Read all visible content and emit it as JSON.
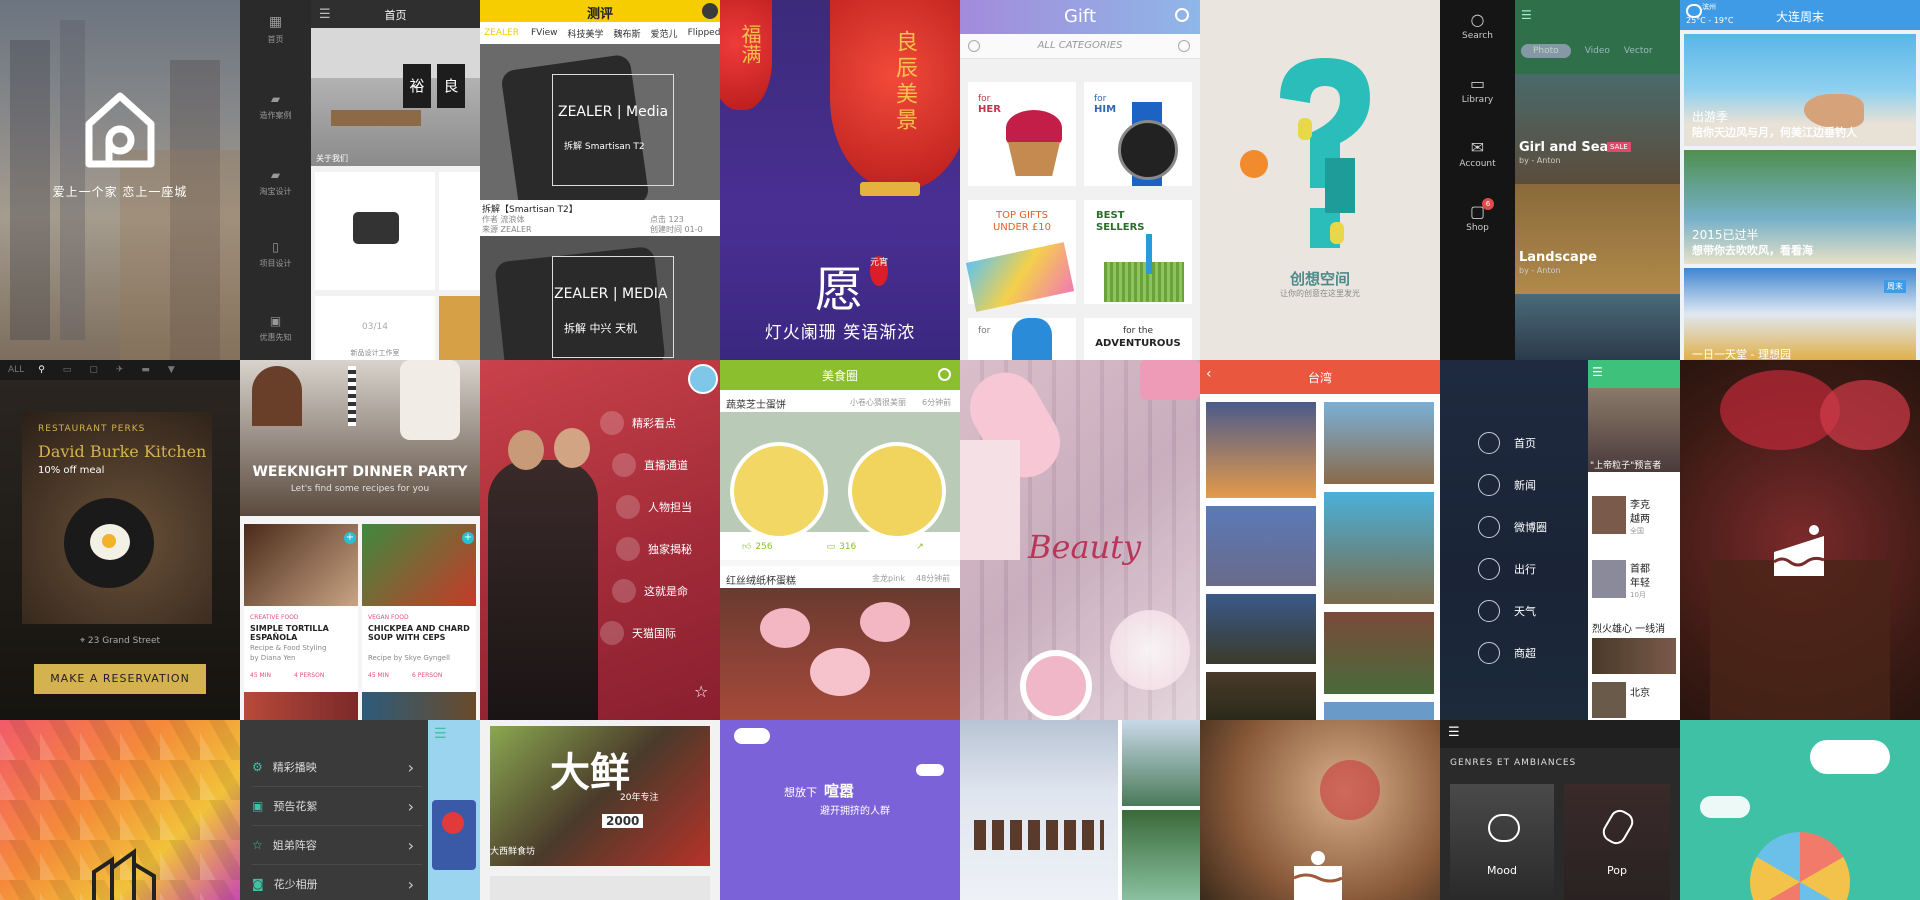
{
  "t_home": {
    "slogan": "爱上一个家 恋上一座城"
  },
  "t_interior": {
    "title": "首页",
    "sidebar": [
      "首页",
      "造作案例",
      "淘宝设计",
      "项目设计",
      "优惠先知"
    ],
    "label_about": "关于我们",
    "page": "03/14",
    "footer": "新品设计工作室",
    "sign_a": "裕",
    "sign_b": "良"
  },
  "t_zealer": {
    "brand": "测评",
    "tabs": [
      "ZEALER",
      "FView",
      "科技美学",
      "魏布斯",
      "爱范儿",
      "Flipped"
    ],
    "card1_logo": "ZEALER | Media",
    "card1_sub": "拆解 Smartisan T2",
    "item_title": "拆解【Smartisan T2】",
    "item_meta1": "作者 流浪体",
    "item_meta2": "来源 ZEALER",
    "item_right1": "点击 123",
    "item_right2": "创建时间 01-0",
    "card2_logo": "ZEALER | MEDIA",
    "card2_sub": "拆解 中兴 天机"
  },
  "t_lantern": {
    "big": "愿",
    "seal": "元宵",
    "line": "灯火阑珊 笑语渐浓",
    "lantern1": "福满",
    "lantern2": "良辰美景"
  },
  "t_gift": {
    "title": "Gift",
    "categories": "ALL CATEGORIES",
    "cells": [
      {
        "pre": "for",
        "main": "HER"
      },
      {
        "pre": "for",
        "main": "HIM"
      },
      {
        "pre": "",
        "main": "TOP GIFTS UNDER £10"
      },
      {
        "pre": "",
        "main": "BEST SELLERS"
      },
      {
        "pre": "",
        "main": "for"
      },
      {
        "pre": "for the",
        "main": "ADVENTUROUS"
      }
    ]
  },
  "t_idea": {
    "name": "创想空间",
    "sub": "让你的创意在这里发光"
  },
  "t_music": {
    "nav": [
      "Search",
      "Library",
      "Account",
      "Shop"
    ],
    "badge": "6",
    "tabs": [
      "Photo",
      "Video",
      "Vector"
    ],
    "items": [
      {
        "title": "Girl and Sea",
        "by": "by - Anton",
        "tag": "SALE"
      },
      {
        "title": "Landscape",
        "by": "by - Anton",
        "tag": ""
      }
    ]
  },
  "t_dalian": {
    "city": "滨州",
    "temp": "25°C - 19°C",
    "title": "大连周末",
    "cards": [
      {
        "a": "出游季",
        "b": "陪你天边风与月，何美江边垂钓人"
      },
      {
        "a": "2015已过半",
        "b": "想带你去吹吹风，看看海"
      },
      {
        "a": "",
        "b": "一日一天堂 - 理想园"
      }
    ],
    "tag": "周末"
  },
  "t_restaurant": {
    "menu": [
      "ALL"
    ],
    "perks": "RESTAURANT PERKS",
    "name": "David Burke Kitchen",
    "off": "10% off meal",
    "address": "23 Grand Street",
    "cta": "MAKE A RESERVATION"
  },
  "t_dinner": {
    "title": "WEEKNIGHT DINNER PARTY",
    "sub": "Let's find some recipes for you",
    "c1_tag": "CREATIVE FOOD",
    "c1_title": "SIMPLE TORTILLA ESPAÑOLA",
    "c1_by": "Recipe & Food Styling",
    "c1_by2": "by Diana Yen",
    "c1_time": "45 MIN",
    "c1_person": "4 PERSON",
    "c2_tag": "VEGAN FOOD",
    "c2_title": "CHICKPEA AND CHARD SOUP WITH CEPS",
    "c2_by": "Recipe by Skye Gyngell",
    "c2_time": "45 MIN",
    "c2_person": "6 PERSON"
  },
  "t_tmall": {
    "menu": [
      "精彩看点",
      "直播通道",
      "人物担当",
      "独家揭秘",
      "这就是命",
      "天猫国际"
    ]
  },
  "t_food": {
    "title": "美食圈",
    "p1": "蔬菜芝士蛋饼",
    "p1_meta": "小卷心猜很美丽",
    "p1_time": "6分钟前",
    "like": "256",
    "comment": "316",
    "p2": "红丝绒纸杯蛋糕",
    "p2_meta": "金龙pink",
    "p2_time": "48分钟前"
  },
  "t_beauty": {
    "word": "Beauty"
  },
  "t_taiwan": {
    "title": "台湾"
  },
  "t_news_menu": {
    "items": [
      "首页",
      "新闻",
      "微博圈",
      "出行",
      "天气",
      "商超"
    ]
  },
  "t_news_list": {
    "head": "\"上帝粒子\"预言者",
    "items": [
      "李克",
      "越两",
      "首都",
      "年轻",
      "烈火雄心 一线消"
    ],
    "meta": [
      "全国",
      "10月"
    ],
    "last": "北京"
  },
  "t_video": {
    "items": [
      "精彩播映",
      "预告花絮",
      "姐弟阵容",
      "花少相册"
    ]
  },
  "t_fresh": {
    "big": "大鲜",
    "sub": "20年专注",
    "year": "2000",
    "caption": "大西鲜食坊"
  },
  "t_quiet": {
    "a": "想放下",
    "b": "喧嚣",
    "c": "避开拥挤的人群"
  },
  "t_genre": {
    "head": "GENRES ET AMBIANCES",
    "g1": "Mood",
    "g2": "Pop"
  },
  "colors": {
    "dark": "#2a2a2a",
    "zealer_yellow": "#f6cd00",
    "gift_purple": "#9b7fd0",
    "food_green": "#8bbf2e",
    "taiwan_red": "#e9573f",
    "quiet_purple": "#7b62d8",
    "teal": "#3ec1a5",
    "gold": "#d4b24f"
  }
}
